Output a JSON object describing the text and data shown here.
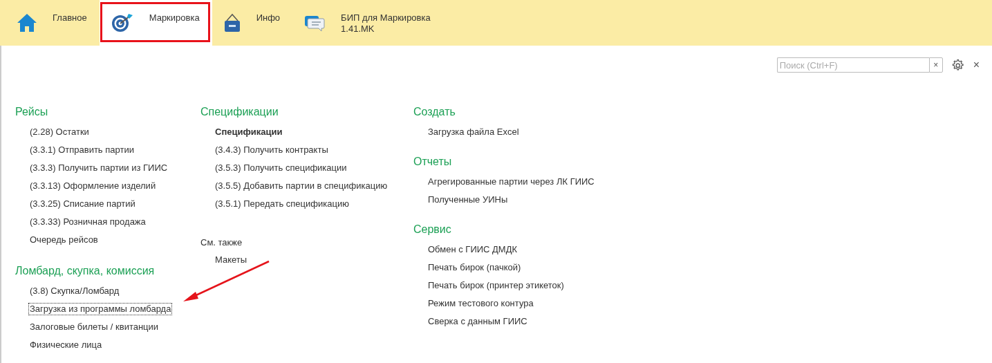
{
  "tabs": [
    {
      "label": "Главное",
      "kind": "home",
      "selected": false,
      "highlighted": false
    },
    {
      "label": "Маркировка",
      "kind": "target",
      "selected": true,
      "highlighted": true
    },
    {
      "label": "Инфо",
      "kind": "sign",
      "selected": false,
      "highlighted": false
    },
    {
      "label": "БИП для Маркировка",
      "sublabel": "1.41.MK",
      "kind": "chat",
      "selected": false,
      "highlighted": false
    }
  ],
  "search": {
    "placeholder": "Поиск (Ctrl+F)",
    "clear": "×"
  },
  "close": "×",
  "columns": [
    [
      {
        "kind": "group",
        "title": "Рейсы",
        "items": [
          {
            "kind": "link",
            "label": "(2.28) Остатки",
            "focused": false
          },
          {
            "kind": "link",
            "label": "(3.3.1) Отправить партии",
            "focused": false
          },
          {
            "kind": "link",
            "label": "(3.3.3) Получить партии из ГИИС",
            "focused": false
          },
          {
            "kind": "link",
            "label": "(3.3.13) Оформление изделий",
            "focused": false
          },
          {
            "kind": "link",
            "label": "(3.3.25) Списание партий",
            "focused": false
          },
          {
            "kind": "link",
            "label": "(3.3.33) Розничная продажа",
            "focused": false
          },
          {
            "kind": "link",
            "label": "Очередь рейсов",
            "focused": false
          }
        ]
      },
      {
        "kind": "group",
        "title": "Ломбард, скупка, комиссия",
        "items": [
          {
            "kind": "link",
            "label": "(3.8) Скупка/Ломбард",
            "focused": false
          },
          {
            "kind": "link",
            "label": "Загрузка из программы ломбарда",
            "focused": true,
            "arrow": true
          },
          {
            "kind": "link",
            "label": "Залоговые билеты / квитанции",
            "focused": false
          },
          {
            "kind": "link",
            "label": "Физические лица",
            "focused": false
          }
        ]
      }
    ],
    [
      {
        "kind": "group",
        "title": "Спецификации",
        "items": [
          {
            "kind": "header",
            "label": "Спецификации",
            "focused": false
          },
          {
            "kind": "link",
            "label": "(3.4.3) Получить контракты",
            "focused": false
          },
          {
            "kind": "link",
            "label": "(3.5.3) Получить спецификации",
            "focused": false
          },
          {
            "kind": "link",
            "label": "(3.5.5) Добавить партии в спецификацию",
            "focused": false
          },
          {
            "kind": "link",
            "label": "(3.5.1) Передать спецификацию",
            "focused": false
          }
        ]
      },
      {
        "kind": "see_also",
        "title": "См. также",
        "items": [
          {
            "kind": "link",
            "label": "Макеты",
            "focused": false
          }
        ]
      }
    ],
    [
      {
        "kind": "group",
        "title": "Создать",
        "items": [
          {
            "kind": "link",
            "label": "Загрузка файла Excel",
            "focused": false
          }
        ]
      },
      {
        "kind": "group",
        "title": "Отчеты",
        "items": [
          {
            "kind": "link",
            "label": "Агрегированные партии через ЛК ГИИС",
            "focused": false
          },
          {
            "kind": "link",
            "label": "Полученные УИНы",
            "focused": false
          }
        ]
      },
      {
        "kind": "group",
        "title": "Сервис",
        "items": [
          {
            "kind": "link",
            "label": "Обмен с ГИИС ДМДК",
            "focused": false
          },
          {
            "kind": "link",
            "label": "Печать бирок (пачкой)",
            "focused": false
          },
          {
            "kind": "link",
            "label": "Печать бирок (принтер этикеток)",
            "focused": false
          },
          {
            "kind": "link",
            "label": "Режим тестового контура",
            "focused": false
          },
          {
            "kind": "link",
            "label": "Сверка с данным ГИИС",
            "focused": false
          }
        ]
      }
    ]
  ]
}
